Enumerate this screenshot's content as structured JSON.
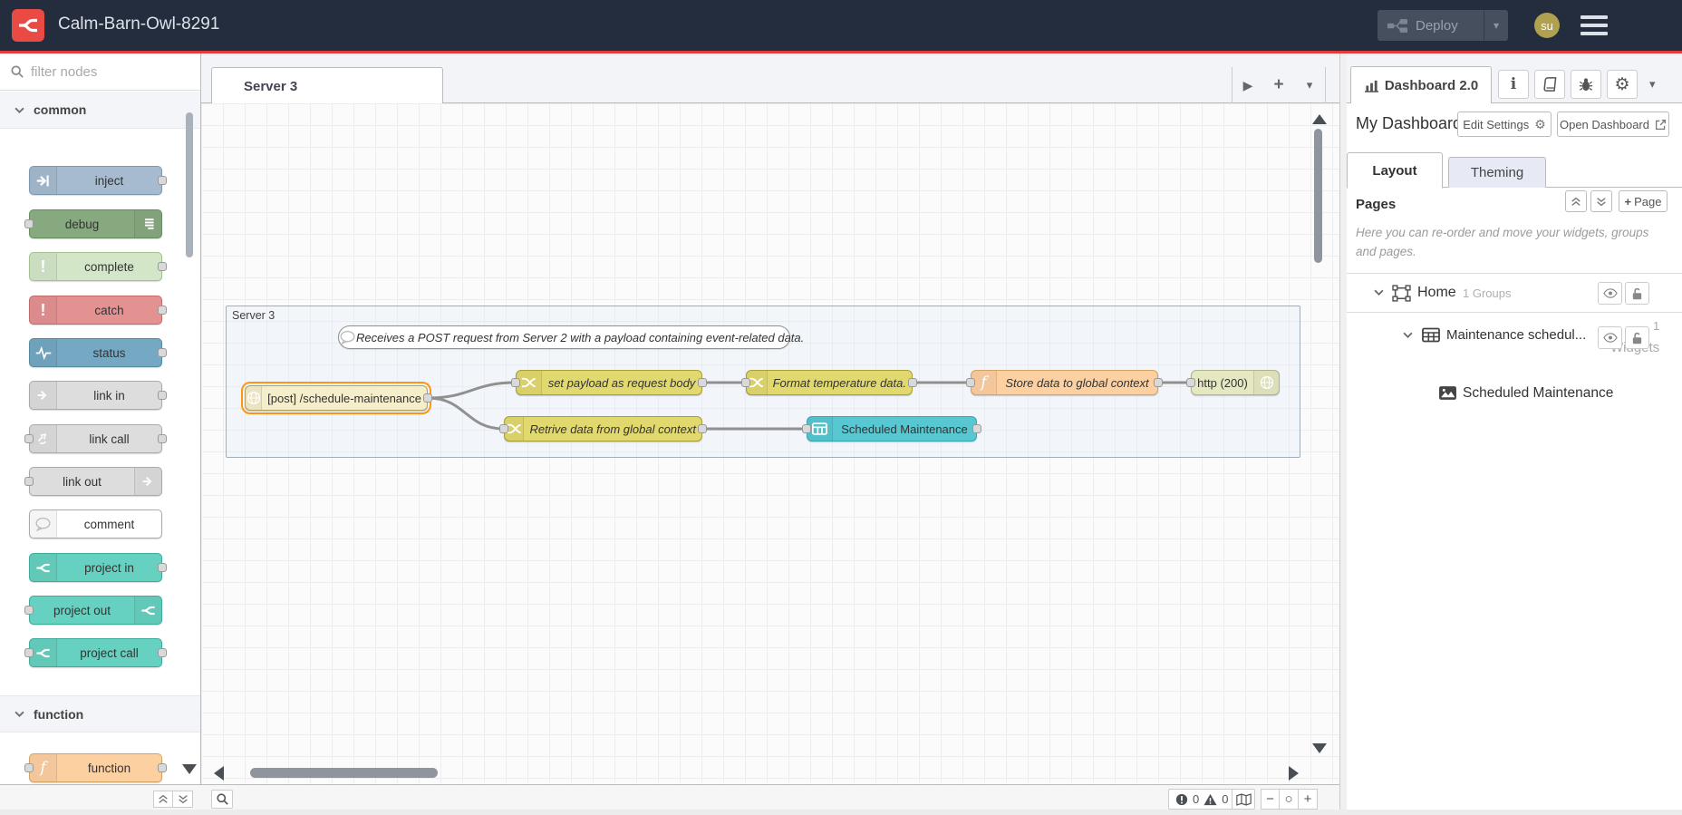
{
  "header": {
    "title": "Calm-Barn-Owl-8291",
    "deploy_label": "Deploy",
    "avatar_text": "su",
    "background_color": "#232d3d",
    "accent_color": "#e23c3c",
    "logo_color": "#e94b44",
    "avatar_color": "#b0a150"
  },
  "palette": {
    "filter_placeholder": "filter nodes",
    "categories": [
      {
        "label": "common",
        "nodes": [
          {
            "label": "inject",
            "color": "#a6bbcf",
            "icon": "inject-arrow-icon",
            "icon_side": "left",
            "ports": "out"
          },
          {
            "label": "debug",
            "color": "#87a980",
            "icon": "debug-lines-icon",
            "icon_side": "right",
            "ports": "in"
          },
          {
            "label": "complete",
            "color": "#d4e6c8",
            "icon": "exclamation-icon",
            "icon_side": "left",
            "ports": "out"
          },
          {
            "label": "catch",
            "color": "#e49191",
            "icon": "exclamation-icon",
            "icon_side": "left",
            "ports": "out"
          },
          {
            "label": "status",
            "color": "#74a8c3",
            "icon": "pulse-icon",
            "icon_side": "left",
            "ports": "out"
          },
          {
            "label": "link in",
            "color": "#dddddd",
            "icon": "link-arrow-icon",
            "icon_side": "left",
            "ports": "out"
          },
          {
            "label": "link call",
            "color": "#dddddd",
            "icon": "link-call-icon",
            "icon_side": "left",
            "ports": "both"
          },
          {
            "label": "link out",
            "color": "#dddddd",
            "icon": "link-arrow-icon",
            "icon_side": "right",
            "ports": "in"
          },
          {
            "label": "comment",
            "color": "#ffffff",
            "icon": "comment-bubble-icon",
            "icon_side": "left",
            "ports": "none"
          },
          {
            "label": "project in",
            "color": "#66d1c0",
            "icon": "node-red-logo-icon",
            "icon_side": "left",
            "ports": "out"
          },
          {
            "label": "project out",
            "color": "#66d1c0",
            "icon": "node-red-logo-icon",
            "icon_side": "right",
            "ports": "in"
          },
          {
            "label": "project call",
            "color": "#66d1c0",
            "icon": "node-red-logo-icon",
            "icon_side": "left",
            "ports": "both"
          }
        ]
      },
      {
        "label": "function",
        "nodes": [
          {
            "label": "function",
            "color": "#fdd0a2",
            "icon": "function-f-icon",
            "icon_side": "left",
            "ports": "both"
          }
        ]
      }
    ]
  },
  "workspace": {
    "tab_label": "Server 3",
    "group_label": "Server 3",
    "comment_text": "Receives a POST request from Server 2 with a payload containing event-related data.",
    "nodes": [
      {
        "label": "[post] /schedule-maintenance",
        "type": "http-in",
        "color": "#f5eecb",
        "selected": true
      },
      {
        "label": "set payload as request body",
        "type": "change",
        "color": "#e2d96e"
      },
      {
        "label": "Format temperature data.",
        "type": "change",
        "color": "#e2d96e"
      },
      {
        "label": "Store data to global context",
        "type": "function",
        "color": "#fdd0a2"
      },
      {
        "label": "http (200)",
        "type": "http-response",
        "color": "#e6e8c2"
      },
      {
        "label": "Retrive data from global context",
        "type": "change",
        "color": "#e2d96e"
      },
      {
        "label": "Scheduled Maintenance",
        "type": "ui-table",
        "color": "#57c7d2"
      }
    ]
  },
  "sidebar": {
    "active_tab": "Dashboard 2.0",
    "icon_tabs": [
      "info-icon",
      "book-icon",
      "bug-icon",
      "gear-icon",
      "chevron-down-icon"
    ],
    "dashboard_name": "My Dashboard",
    "edit_settings_label": "Edit Settings",
    "open_dashboard_label": "Open Dashboard",
    "tabs": [
      {
        "label": "Layout",
        "active": true
      },
      {
        "label": "Theming",
        "active": false
      }
    ],
    "pages_heading": "Pages",
    "add_page_label": "Page",
    "hint": "Here you can re-order and move your widgets, groups and pages.",
    "tree": {
      "page_name": "Home",
      "page_count": "1 Groups",
      "group_name": "Maintenance schedul...",
      "group_count_line1": "1",
      "group_count_line2": "Widgets",
      "widget_name": "Scheduled Maintenance"
    }
  },
  "statusbar": {
    "error_count": "0",
    "warning_count": "0"
  },
  "icons": {
    "plus": "+",
    "minus": "−",
    "zoom_reset": "○",
    "caret_down": "▾",
    "play_right": "▶",
    "exclamation": "!",
    "gear": "⚙",
    "info": "i",
    "function_f": "f"
  }
}
